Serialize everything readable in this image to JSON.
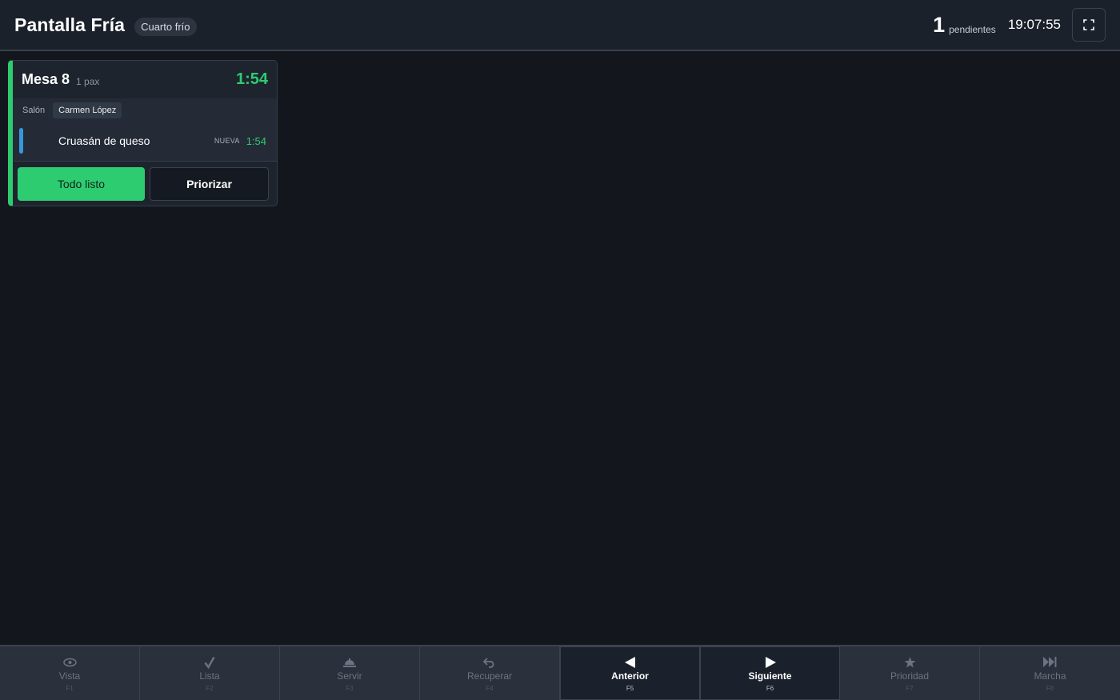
{
  "header": {
    "title": "Pantalla Fría",
    "station": "Cuarto frío",
    "pending_count": "1",
    "pending_label": "pendientes",
    "clock": "19:07:55"
  },
  "ticket": {
    "table": "Mesa 8",
    "pax": "1 pax",
    "timer": "1:54",
    "zone": "Salón",
    "waiter": "Carmen López",
    "items": [
      {
        "name": "Cruasán de queso",
        "status": "NUEVA",
        "timer": "1:54"
      }
    ],
    "ready_label": "Todo listo",
    "priority_label": "Priorizar",
    "accent_color": "#2ecc71"
  },
  "function_keys": [
    {
      "label": "Vista",
      "key": "F1",
      "icon": "eye-icon"
    },
    {
      "label": "Lista",
      "key": "F2",
      "icon": "check-icon"
    },
    {
      "label": "Servir",
      "key": "F3",
      "icon": "dish-icon"
    },
    {
      "label": "Recuperar",
      "key": "F4",
      "icon": "undo-icon"
    },
    {
      "label": "Anterior",
      "key": "F5",
      "icon": "arrow-left-icon"
    },
    {
      "label": "Siguiente",
      "key": "F6",
      "icon": "arrow-right-icon"
    },
    {
      "label": "Prioridad",
      "key": "F7",
      "icon": "star-icon"
    },
    {
      "label": "Marcha",
      "key": "F8",
      "icon": "skip-forward-icon"
    }
  ]
}
